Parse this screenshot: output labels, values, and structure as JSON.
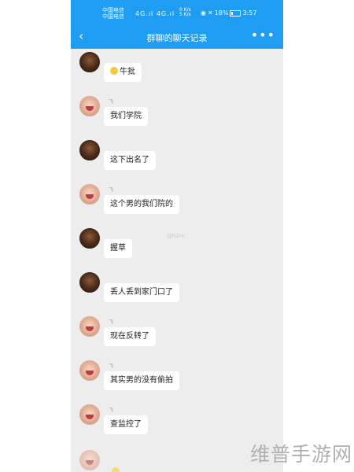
{
  "status_bar": {
    "carrier_1": "中国电信",
    "carrier_2": "中国电信",
    "signal_text": "4G.ıl 4G.ıl",
    "net_1": "0 K/s",
    "net_2": "5 K/s",
    "battery_text": "18%",
    "time": "3:57"
  },
  "nav": {
    "back_glyph": "‹",
    "title": "群聊的聊天记录",
    "more_glyph": "•••"
  },
  "messages": [
    {
      "sender": "dark",
      "nick": "",
      "text": "牛批",
      "emoji": true
    },
    {
      "sender": "light",
      "nick": "飞",
      "text": "我们学院"
    },
    {
      "sender": "dark",
      "nick": "",
      "text": "这下出名了"
    },
    {
      "sender": "light",
      "nick": "飞",
      "text": "这个男的我们院的"
    },
    {
      "sender": "dark",
      "nick": "",
      "text": "握草"
    },
    {
      "sender": "dark",
      "nick": "",
      "text": "丢人丢到家门口了"
    },
    {
      "sender": "light",
      "nick": "飞",
      "text": "现在反转了"
    },
    {
      "sender": "light",
      "nick": "飞",
      "text": "其实男的没有偷拍"
    },
    {
      "sender": "light",
      "nick": "飞",
      "text": "查监控了"
    }
  ],
  "inner_watermark": "@h2m",
  "watermark": "维普手游网",
  "colors": {
    "header": "#1e9df2",
    "chat_bg": "#ededed",
    "bubble": "#ffffff"
  }
}
